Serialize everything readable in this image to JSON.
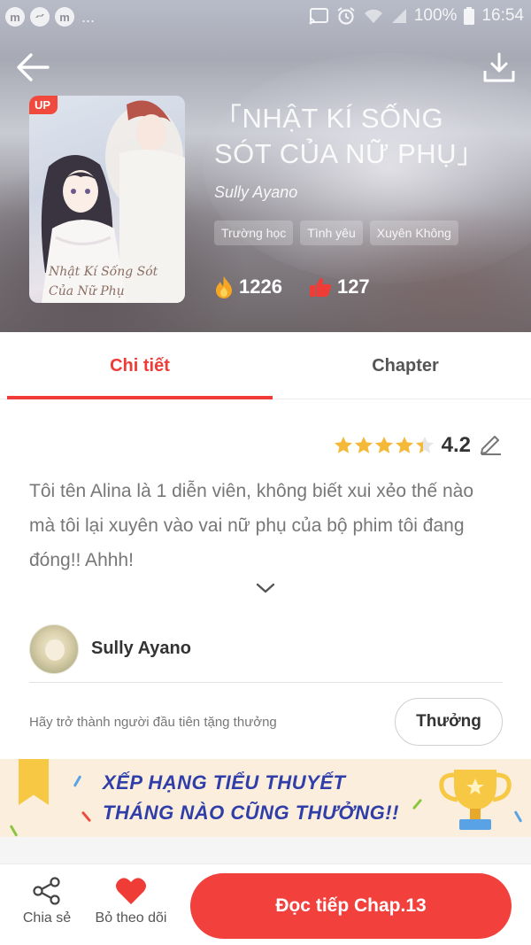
{
  "status_bar": {
    "notif_icons": [
      "m",
      "messenger",
      "m"
    ],
    "more": "...",
    "battery": "100%",
    "time": "16:54"
  },
  "header": {
    "back_icon": "arrow-left-icon",
    "download_icon": "download-icon"
  },
  "book": {
    "badge": "UP",
    "cover_title": "Nhật Kí Sống Sót Của Nữ Phụ",
    "title": "「NHẬT KÍ SỐNG SÓT CỦA NỮ PHỤ」",
    "author": "Sully Ayano",
    "tags": [
      "Trường học",
      "Tình yêu",
      "Xuyên Không"
    ],
    "views": "1226",
    "likes": "127"
  },
  "tabs": [
    {
      "label": "Chi tiết",
      "active": true
    },
    {
      "label": "Chapter",
      "active": false
    }
  ],
  "rating": {
    "value": "4.2",
    "stars": 4.2
  },
  "description": "Tôi tên Alina là 1 diễn viên, không biết xui xẻo thế nào mà tôi lại xuyên vào vai nữ phụ của bộ phim tôi đang đóng!! Ahhh!",
  "author_section": {
    "name": "Sully Ayano"
  },
  "reward": {
    "text": "Hãy trở thành người đầu tiên tặng thưởng",
    "button": "Thưởng"
  },
  "banner": {
    "line1": "XẾP HẠNG TIỂU THUYẾT",
    "line2": "THÁNG NÀO CŨNG THƯỞNG!!"
  },
  "bottom_bar": {
    "share_label": "Chia sẻ",
    "follow_label": "Bỏ theo dõi",
    "read_button": "Đọc tiếp Chap.13"
  },
  "colors": {
    "accent": "#ef3c36",
    "star": "#f5b93a",
    "banner_text": "#2f3ea9"
  }
}
